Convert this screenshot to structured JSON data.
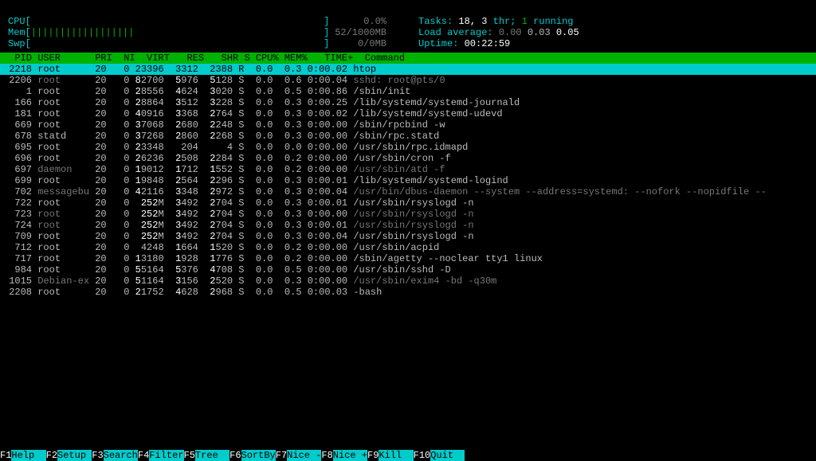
{
  "meters": {
    "cpu": {
      "label": "CPU",
      "bar": "                                                   ",
      "pct": "0.0%"
    },
    "mem": {
      "label": "Mem",
      "bar": "||||||||||||||||||                                 ",
      "used": "52/1000MB"
    },
    "swp": {
      "label": "Swp",
      "bar": "                                                   ",
      "used": "0/0MB"
    }
  },
  "stats": {
    "tasks_label": "Tasks: ",
    "tasks_val": "18, 3 ",
    "thr_label": "thr; ",
    "running": "1 ",
    "running_label": "running",
    "load_label": "Load average: ",
    "l1": "0.00 ",
    "l2": "0.03 ",
    "l3": "0.05",
    "uptime_label": "Uptime: ",
    "uptime": "00:22:59"
  },
  "columns": "  PID USER      PRI  NI  VIRT   RES   SHR S CPU% MEM%   TIME+  Command",
  "rows": [
    {
      "sel": true,
      "pid": " 2218",
      "user": "root     ",
      "pri": " 20",
      "ni": "  0",
      "virt": " 23396",
      "res": "  3312",
      "shr": "  2388",
      "s": "R",
      "cpu": "  0.0",
      "mem": " 0.3",
      "time": " 0:00.02",
      "cmd": "htop"
    },
    {
      "pid": " 2206",
      "user": "root     ",
      "pri": " 20",
      "ni": "  0",
      "virt": " 82700",
      "res": "  5976",
      "shr": "  5128",
      "s": "S",
      "cpu": "  0.0",
      "mem": " 0.6",
      "time": " 0:00.04",
      "cmd": "sshd: root@pts/0",
      "grey": true
    },
    {
      "pid": "    1",
      "user": "root     ",
      "pri": " 20",
      "ni": "  0",
      "virt": " 28556",
      "res": "  4624",
      "shr": "  3020",
      "s": "S",
      "cpu": "  0.0",
      "mem": " 0.5",
      "time": " 0:00.86",
      "cmd": "/sbin/init"
    },
    {
      "pid": "  166",
      "user": "root     ",
      "pri": " 20",
      "ni": "  0",
      "virt": " 28864",
      "res": "  3512",
      "shr": "  3228",
      "s": "S",
      "cpu": "  0.0",
      "mem": " 0.3",
      "time": " 0:00.25",
      "cmd": "/lib/systemd/systemd-journald"
    },
    {
      "pid": "  181",
      "user": "root     ",
      "pri": " 20",
      "ni": "  0",
      "virt": " 40916",
      "res": "  3368",
      "shr": "  2764",
      "s": "S",
      "cpu": "  0.0",
      "mem": " 0.3",
      "time": " 0:00.02",
      "cmd": "/lib/systemd/systemd-udevd"
    },
    {
      "pid": "  669",
      "user": "root     ",
      "pri": " 20",
      "ni": "  0",
      "virt": " 37068",
      "res": "  2680",
      "shr": "  2248",
      "s": "S",
      "cpu": "  0.0",
      "mem": " 0.3",
      "time": " 0:00.00",
      "cmd": "/sbin/rpcbind -w"
    },
    {
      "pid": "  678",
      "user": "statd    ",
      "pri": " 20",
      "ni": "  0",
      "virt": " 37268",
      "res": "  2860",
      "shr": "  2268",
      "s": "S",
      "cpu": "  0.0",
      "mem": " 0.3",
      "time": " 0:00.00",
      "cmd": "/sbin/rpc.statd"
    },
    {
      "pid": "  695",
      "user": "root     ",
      "pri": " 20",
      "ni": "  0",
      "virt": " 23348",
      "res": "   204",
      "shr": "     4",
      "s": "S",
      "cpu": "  0.0",
      "mem": " 0.0",
      "time": " 0:00.00",
      "cmd": "/usr/sbin/rpc.idmapd"
    },
    {
      "pid": "  696",
      "user": "root     ",
      "pri": " 20",
      "ni": "  0",
      "virt": " 26236",
      "res": "  2508",
      "shr": "  2284",
      "s": "S",
      "cpu": "  0.0",
      "mem": " 0.2",
      "time": " 0:00.00",
      "cmd": "/usr/sbin/cron -f"
    },
    {
      "pid": "  697",
      "user": "daemon   ",
      "pri": " 20",
      "ni": "  0",
      "virt": " 19012",
      "res": "  1712",
      "shr": "  1552",
      "s": "S",
      "cpu": "  0.0",
      "mem": " 0.2",
      "time": " 0:00.00",
      "cmd": "/usr/sbin/atd -f",
      "grey": true
    },
    {
      "pid": "  699",
      "user": "root     ",
      "pri": " 20",
      "ni": "  0",
      "virt": " 19848",
      "res": "  2564",
      "shr": "  2296",
      "s": "S",
      "cpu": "  0.0",
      "mem": " 0.3",
      "time": " 0:00.01",
      "cmd": "/lib/systemd/systemd-logind"
    },
    {
      "pid": "  702",
      "user": "messagebu",
      "pri": " 20",
      "ni": "  0",
      "virt": " 42116",
      "res": "  3348",
      "shr": "  2972",
      "s": "S",
      "cpu": "  0.0",
      "mem": " 0.3",
      "time": " 0:00.04",
      "cmd": "/usr/bin/dbus-daemon --system --address=systemd: --nofork --nopidfile --",
      "grey": true
    },
    {
      "pid": "  722",
      "user": "root     ",
      "pri": " 20",
      "ni": "  0",
      "virt": "  252M",
      "res": "  3492",
      "shr": "  2704",
      "s": "S",
      "cpu": "  0.0",
      "mem": " 0.3",
      "time": " 0:00.01",
      "cmd": "/usr/sbin/rsyslogd -n"
    },
    {
      "pid": "  723",
      "user": "root     ",
      "pri": " 20",
      "ni": "  0",
      "virt": "  252M",
      "res": "  3492",
      "shr": "  2704",
      "s": "S",
      "cpu": "  0.0",
      "mem": " 0.3",
      "time": " 0:00.00",
      "cmd": "/usr/sbin/rsyslogd -n",
      "grey": true
    },
    {
      "pid": "  724",
      "user": "root     ",
      "pri": " 20",
      "ni": "  0",
      "virt": "  252M",
      "res": "  3492",
      "shr": "  2704",
      "s": "S",
      "cpu": "  0.0",
      "mem": " 0.3",
      "time": " 0:00.01",
      "cmd": "/usr/sbin/rsyslogd -n",
      "grey": true
    },
    {
      "pid": "  709",
      "user": "root     ",
      "pri": " 20",
      "ni": "  0",
      "virt": "  252M",
      "res": "  3492",
      "shr": "  2704",
      "s": "S",
      "cpu": "  0.0",
      "mem": " 0.3",
      "time": " 0:00.04",
      "cmd": "/usr/sbin/rsyslogd -n"
    },
    {
      "pid": "  712",
      "user": "root     ",
      "pri": " 20",
      "ni": "  0",
      "virt": "  4248",
      "res": "  1664",
      "shr": "  1520",
      "s": "S",
      "cpu": "  0.0",
      "mem": " 0.2",
      "time": " 0:00.00",
      "cmd": "/usr/sbin/acpid"
    },
    {
      "pid": "  717",
      "user": "root     ",
      "pri": " 20",
      "ni": "  0",
      "virt": " 13180",
      "res": "  1928",
      "shr": "  1776",
      "s": "S",
      "cpu": "  0.0",
      "mem": " 0.2",
      "time": " 0:00.00",
      "cmd": "/sbin/agetty --noclear tty1 linux"
    },
    {
      "pid": "  984",
      "user": "root     ",
      "pri": " 20",
      "ni": "  0",
      "virt": " 55164",
      "res": "  5376",
      "shr": "  4708",
      "s": "S",
      "cpu": "  0.0",
      "mem": " 0.5",
      "time": " 0:00.00",
      "cmd": "/usr/sbin/sshd -D"
    },
    {
      "pid": " 1015",
      "user": "Debian-ex",
      "pri": " 20",
      "ni": "  0",
      "virt": " 51164",
      "res": "  3156",
      "shr": "  2520",
      "s": "S",
      "cpu": "  0.0",
      "mem": " 0.3",
      "time": " 0:00.00",
      "cmd": "/usr/sbin/exim4 -bd -q30m",
      "grey": true
    },
    {
      "pid": " 2208",
      "user": "root     ",
      "pri": " 20",
      "ni": "  0",
      "virt": " 21752",
      "res": "  4628",
      "shr": "  2968",
      "s": "S",
      "cpu": "  0.0",
      "mem": " 0.5",
      "time": " 0:00.03",
      "cmd": "-bash"
    }
  ],
  "fkeys": [
    {
      "k": "F1",
      "l": "Help  "
    },
    {
      "k": "F2",
      "l": "Setup "
    },
    {
      "k": "F3",
      "l": "Search"
    },
    {
      "k": "F4",
      "l": "Filter"
    },
    {
      "k": "F5",
      "l": "Tree  "
    },
    {
      "k": "F6",
      "l": "SortBy"
    },
    {
      "k": "F7",
      "l": "Nice -"
    },
    {
      "k": "F8",
      "l": "Nice +"
    },
    {
      "k": "F9",
      "l": "Kill  "
    },
    {
      "k": "F10",
      "l": "Quit  "
    }
  ]
}
